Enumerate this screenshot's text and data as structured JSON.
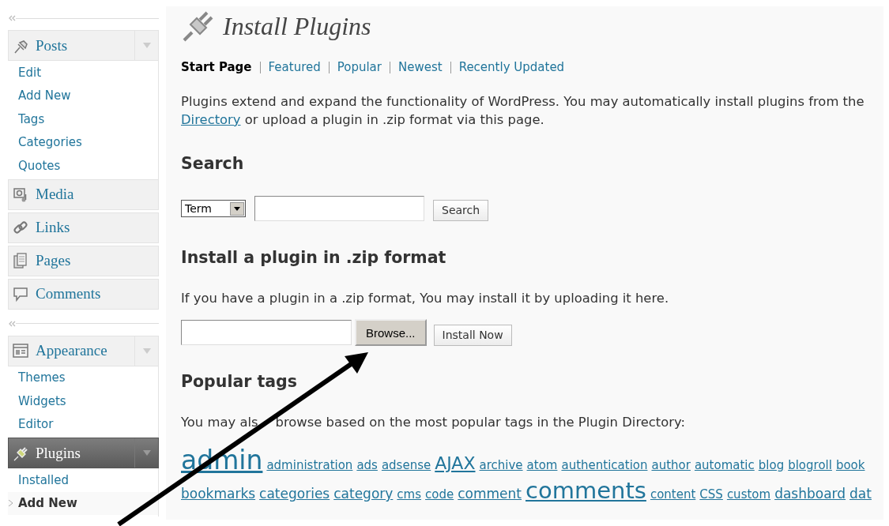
{
  "sidebar": {
    "groups": [
      {
        "sections": [
          {
            "label": "Posts",
            "kind": "expandable",
            "selected": false,
            "items": [
              {
                "label": "Edit",
                "selected": false
              },
              {
                "label": "Add New",
                "selected": false
              },
              {
                "label": "Tags",
                "selected": false
              },
              {
                "label": "Categories",
                "selected": false
              },
              {
                "label": "Quotes",
                "selected": false
              }
            ]
          },
          {
            "label": "Media",
            "kind": "plain",
            "selected": false
          },
          {
            "label": "Links",
            "kind": "plain",
            "selected": false
          },
          {
            "label": "Pages",
            "kind": "plain",
            "selected": false
          },
          {
            "label": "Comments",
            "kind": "plain",
            "selected": false
          }
        ]
      },
      {
        "sections": [
          {
            "label": "Appearance",
            "kind": "expandable",
            "selected": false,
            "items": [
              {
                "label": "Themes",
                "selected": false
              },
              {
                "label": "Widgets",
                "selected": false
              },
              {
                "label": "Editor",
                "selected": false
              }
            ]
          },
          {
            "label": "Plugins",
            "kind": "expandable",
            "selected": true,
            "items": [
              {
                "label": "Installed",
                "selected": false
              },
              {
                "label": "Add New",
                "selected": true
              }
            ]
          }
        ]
      }
    ]
  },
  "page": {
    "title": "Install Plugins",
    "tabs": [
      {
        "label": "Start Page",
        "selected": true
      },
      {
        "label": "Featured",
        "selected": false
      },
      {
        "label": "Popular",
        "selected": false
      },
      {
        "label": "Newest",
        "selected": false
      },
      {
        "label": "Recently Updated",
        "selected": false
      }
    ],
    "intro": {
      "line1": "Plugins extend and expand the functionality of WordPress. You may automatically install plugins from the",
      "link": "Directory",
      "rest": " or upload a plugin in .zip format via this page."
    },
    "search": {
      "heading": "Search",
      "type_select": "Term",
      "button": "Search"
    },
    "upload": {
      "heading": "Install a plugin in .zip format",
      "text": "If you have a plugin in a .zip format, You may install it by uploading it here.",
      "browse_button": "Browse...",
      "install_button": "Install Now"
    },
    "tags": {
      "heading": "Popular tags",
      "text_before_arrow": "You may als",
      "text_after_arrow": "browse based on the most popular tags in the Plugin Directory:",
      "lines": [
        {
          "tags": [
            {
              "label": "admin",
              "kind": "huge"
            },
            {
              "label": "administration",
              "kind": "small"
            },
            {
              "label": "ads",
              "kind": "small"
            },
            {
              "label": "adsense",
              "kind": "small"
            },
            {
              "label": "AJAX",
              "kind": "large"
            },
            {
              "label": "archive",
              "kind": "small"
            },
            {
              "label": "atom",
              "kind": "small"
            },
            {
              "label": "authentication",
              "kind": "small"
            },
            {
              "label": "author",
              "kind": "small"
            },
            {
              "label": "automatic",
              "kind": "small"
            },
            {
              "label": "blog",
              "kind": "small"
            },
            {
              "label": "blogroll",
              "kind": "small"
            },
            {
              "label": "book",
              "kind": "small"
            }
          ]
        },
        {
          "tags": [
            {
              "label": "bookmarks",
              "kind": "medium"
            },
            {
              "label": "categories",
              "kind": "medium"
            },
            {
              "label": "category",
              "kind": "medium"
            },
            {
              "label": "cms",
              "kind": "small"
            },
            {
              "label": "code",
              "kind": "small"
            },
            {
              "label": "comment",
              "kind": "medium"
            },
            {
              "label": "comments",
              "kind": "xlarge"
            },
            {
              "label": "content",
              "kind": "small"
            },
            {
              "label": "CSS",
              "kind": "small"
            },
            {
              "label": "custom",
              "kind": "small"
            },
            {
              "label": "dashboard",
              "kind": "medium"
            },
            {
              "label": "dat",
              "kind": "medium"
            }
          ]
        }
      ]
    }
  }
}
